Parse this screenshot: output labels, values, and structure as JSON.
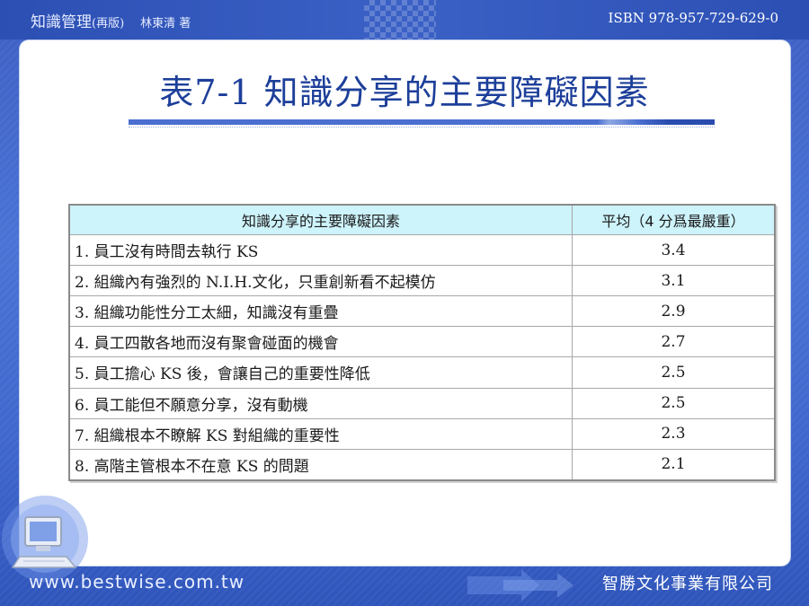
{
  "header": {
    "book_title": "知識管理",
    "edition": "(再版)",
    "author": "林東清 著",
    "isbn": "ISBN 978-957-729-629-0"
  },
  "slide": {
    "title": "表7-1 知識分享的主要障礙因素"
  },
  "table": {
    "columns": [
      "知識分享的主要障礙因素",
      "平均（4 分爲最嚴重）"
    ],
    "rows": [
      {
        "item": "1. 員工沒有時間去執行 KS",
        "avg": "3.4"
      },
      {
        "item": "2. 組織內有強烈的 N.I.H.文化，只重創新看不起模仿",
        "avg": "3.1"
      },
      {
        "item": "3. 組織功能性分工太細，知識沒有重疊",
        "avg": "2.9"
      },
      {
        "item": "4. 員工四散各地而沒有聚會碰面的機會",
        "avg": "2.7"
      },
      {
        "item": "5. 員工擔心 KS 後，會讓自己的重要性降低",
        "avg": "2.5"
      },
      {
        "item": "6. 員工能但不願意分享，沒有動機",
        "avg": "2.5"
      },
      {
        "item": "7. 組織根本不瞭解 KS 對組織的重要性",
        "avg": "2.3"
      },
      {
        "item": "8. 高階主管根本不在意 KS 的問題",
        "avg": "2.1"
      }
    ]
  },
  "footer": {
    "url": "www.bestwise.com.tw",
    "publisher": "智勝文化事業有限公司",
    "icon": "computer-icon"
  },
  "colors": {
    "background": "#3a63c8",
    "title": "#1d3f9a",
    "table_header": "#cdf3fb"
  }
}
